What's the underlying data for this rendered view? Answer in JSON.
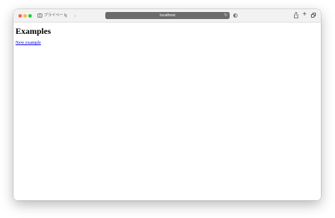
{
  "browser": {
    "private_label": "プライベート",
    "address_text": "localhost",
    "icons": {
      "sidebar": "sidebar-toggle-icon",
      "back": "chevron-left-icon",
      "forward": "chevron-right-icon",
      "reload": "reload-icon",
      "reader": "reader-mode-icon",
      "share": "share-icon",
      "new_tab": "plus-icon",
      "tab_overview": "tab-overview-icon"
    },
    "colors": {
      "close": "#ff5f57",
      "minimize": "#febc2e",
      "maximize": "#28c840",
      "address_bar": "#6b6b6b"
    }
  },
  "page": {
    "heading": "Examples",
    "link_text": "New example",
    "link_color": "#0000ee"
  },
  "glyphs": {
    "back": "‹",
    "forward": "›",
    "reload": "↻",
    "plus": "+"
  }
}
